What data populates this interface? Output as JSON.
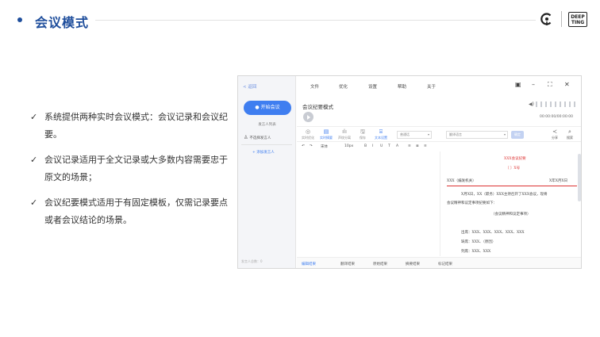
{
  "slide": {
    "title": "会议模式",
    "logo_text": "DEEP\nTING"
  },
  "points": [
    "系统提供两种实时会议模式：会议记录和会议纪要。",
    "会议记录适用于全文记录或大多数内容需要忠于原文的场景；",
    "会议纪要模式适用于有固定模板，仅需记录要点或者会议结论的场景。"
  ],
  "app": {
    "sidebar": {
      "back": "< 返回",
      "start_button": "开始会议",
      "speaker_list": "发言人列表",
      "no_speaker": "不选择发言人",
      "add_speaker": "+ 添加发言人",
      "footer": "发言人总数：0"
    },
    "menu": [
      "文件",
      "优化",
      "设置",
      "帮助",
      "关于"
    ],
    "window_buttons": {
      "icon": "▣",
      "minimize": "–",
      "maximize": "⛶",
      "close": "✕"
    },
    "doc_title": "会议纪要模式",
    "time": "00:00:00/00:00:00",
    "tools": [
      {
        "icon": "◎",
        "label": "实时优化",
        "active": false
      },
      {
        "icon": "▤",
        "label": "实时摘要",
        "active": true
      },
      {
        "icon": "ılı",
        "label": "声纹分离",
        "active": false
      },
      {
        "icon": "🖫",
        "label": "保存",
        "active": false
      },
      {
        "icon": "⌸",
        "label": "文本设置",
        "active": true
      }
    ],
    "select1": "普通话",
    "select2": "翻译语言",
    "apply": "确定",
    "share": "分享",
    "search": "搜索",
    "fmt": {
      "font": "宋体",
      "size": "10px",
      "bold": "B",
      "italic": "I",
      "underline": "U",
      "strike": "T",
      "color": "A"
    },
    "document": {
      "heading": "XXX会议纪要",
      "number": "〔      〕X号",
      "org": "XXX（编发机关）",
      "date": "X年X月X日",
      "line1": "X月X日，XX（职务）XXX主持召开了XXX会议，现将",
      "line2": "会议精神和议定事项纪要如下：",
      "line3": "（会议精神和议定事项）",
      "attend": "出席：XXX、XXX、XXX、XXX、XXX",
      "absent": "缺席：XXX、（原因）",
      "present": "列席：XXX、XXX"
    },
    "tabs": [
      "编辑结果",
      "翻译结果",
      "原始结果",
      "摘要结果",
      "标记结果"
    ]
  }
}
